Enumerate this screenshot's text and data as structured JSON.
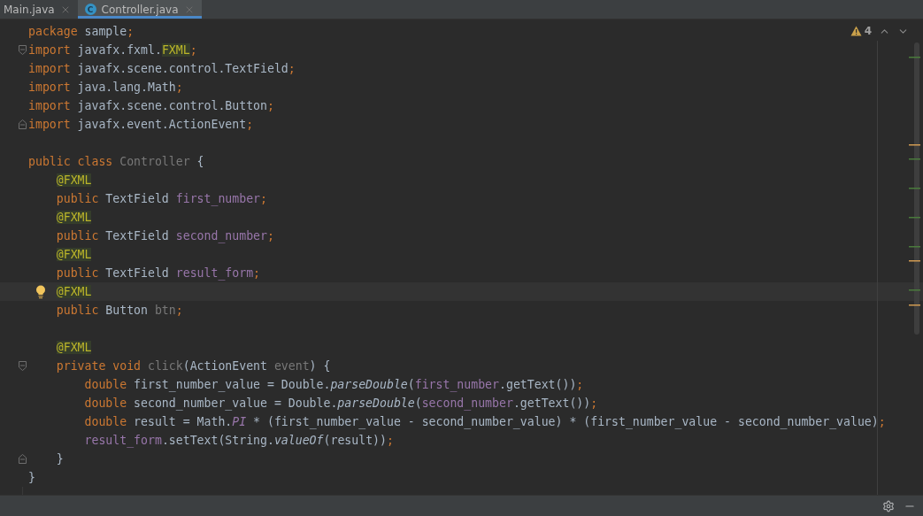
{
  "tabs": [
    {
      "label": "Main.java",
      "selected": false
    },
    {
      "label": "Controller.java",
      "selected": true,
      "icon_letter": "C"
    }
  ],
  "inspections": {
    "warning_count": "4"
  },
  "lines": [
    {
      "current": false,
      "fold_start": false,
      "fold_end": false,
      "tokens": [
        {
          "kind": "kw",
          "text": "package"
        },
        {
          "kind": "plain",
          "text": " sample"
        },
        {
          "kind": "punct",
          "text": ";"
        }
      ]
    },
    {
      "current": false,
      "fold_start": true,
      "fold_end": false,
      "tokens": [
        {
          "kind": "kw",
          "text": "import"
        },
        {
          "kind": "plain",
          "text": " javafx.fxml."
        },
        {
          "kind": "ann",
          "text": "FXML"
        },
        {
          "kind": "punct",
          "text": ";"
        }
      ]
    },
    {
      "current": false,
      "fold_start": false,
      "fold_end": false,
      "tokens": [
        {
          "kind": "kw",
          "text": "import"
        },
        {
          "kind": "plain",
          "text": " javafx.scene.control.TextField"
        },
        {
          "kind": "punct",
          "text": ";"
        }
      ]
    },
    {
      "current": false,
      "fold_start": false,
      "fold_end": false,
      "tokens": [
        {
          "kind": "kw",
          "text": "import"
        },
        {
          "kind": "plain",
          "text": " java.lang.Math"
        },
        {
          "kind": "punct",
          "text": ";"
        }
      ]
    },
    {
      "current": false,
      "fold_start": false,
      "fold_end": false,
      "tokens": [
        {
          "kind": "kw",
          "text": "import"
        },
        {
          "kind": "plain",
          "text": " javafx.scene.control.Button"
        },
        {
          "kind": "punct",
          "text": ";"
        }
      ]
    },
    {
      "current": false,
      "fold_start": false,
      "fold_end": true,
      "tokens": [
        {
          "kind": "kw",
          "text": "import"
        },
        {
          "kind": "plain",
          "text": " javafx.event.ActionEvent"
        },
        {
          "kind": "punct",
          "text": ";"
        }
      ]
    },
    {
      "current": false,
      "fold_start": false,
      "fold_end": false
    },
    {
      "current": false,
      "fold_start": false,
      "fold_end": false,
      "tokens": [
        {
          "kind": "kw",
          "text": "public class "
        },
        {
          "kind": "unused",
          "text": "Controller"
        },
        {
          "kind": "plain",
          "text": " {"
        }
      ]
    },
    {
      "current": false,
      "fold_start": false,
      "fold_end": false,
      "tokens": [
        {
          "kind": "ann",
          "text": "    @FXML"
        }
      ]
    },
    {
      "current": false,
      "fold_start": false,
      "fold_end": false,
      "tokens": [
        {
          "kind": "kw",
          "text": "    public "
        },
        {
          "kind": "plain",
          "text": "TextField "
        },
        {
          "kind": "field",
          "text": "first_number"
        },
        {
          "kind": "punct",
          "text": ";"
        }
      ]
    },
    {
      "current": false,
      "fold_start": false,
      "fold_end": false,
      "tokens": [
        {
          "kind": "ann",
          "text": "    @FXML"
        }
      ]
    },
    {
      "current": false,
      "fold_start": false,
      "fold_end": false,
      "tokens": [
        {
          "kind": "kw",
          "text": "    public "
        },
        {
          "kind": "plain",
          "text": "TextField "
        },
        {
          "kind": "field",
          "text": "second_number"
        },
        {
          "kind": "punct",
          "text": ";"
        }
      ]
    },
    {
      "current": false,
      "fold_start": false,
      "fold_end": false,
      "tokens": [
        {
          "kind": "ann",
          "text": "    @FXML"
        }
      ]
    },
    {
      "current": false,
      "fold_start": false,
      "fold_end": false,
      "tokens": [
        {
          "kind": "kw",
          "text": "    public "
        },
        {
          "kind": "plain",
          "text": "TextField "
        },
        {
          "kind": "field",
          "text": "result_form"
        },
        {
          "kind": "punct",
          "text": ";"
        }
      ]
    },
    {
      "current": true,
      "fold_start": false,
      "fold_end": false,
      "tokens": [
        {
          "kind": "ann",
          "text": "    @FXML"
        }
      ]
    },
    {
      "current": false,
      "fold_start": false,
      "fold_end": false,
      "tokens": [
        {
          "kind": "kw",
          "text": "    public "
        },
        {
          "kind": "plain",
          "text": "Button "
        },
        {
          "kind": "unused",
          "text": "btn"
        },
        {
          "kind": "punct",
          "text": ";"
        }
      ]
    },
    {
      "current": false,
      "fold_start": false,
      "fold_end": false
    },
    {
      "current": false,
      "fold_start": false,
      "fold_end": false,
      "tokens": [
        {
          "kind": "ann",
          "text": "    @FXML"
        }
      ]
    },
    {
      "current": false,
      "fold_start": true,
      "fold_end": false,
      "tokens": [
        {
          "kind": "kw",
          "text": "    private void "
        },
        {
          "kind": "unused",
          "text": "click"
        },
        {
          "kind": "plain",
          "text": "(ActionEvent "
        },
        {
          "kind": "unused",
          "text": "event"
        },
        {
          "kind": "plain",
          "text": ") {"
        }
      ]
    },
    {
      "current": false,
      "fold_start": false,
      "fold_end": false,
      "tokens": [
        {
          "kind": "kw",
          "text": "        double "
        },
        {
          "kind": "plain",
          "text": "first_number_value = Double."
        },
        {
          "kind": "static_m",
          "text": "parseDouble"
        },
        {
          "kind": "plain",
          "text": "("
        },
        {
          "kind": "field",
          "text": "first_number"
        },
        {
          "kind": "plain",
          "text": ".getText())"
        },
        {
          "kind": "punct",
          "text": ";"
        }
      ]
    },
    {
      "current": false,
      "fold_start": false,
      "fold_end": false,
      "tokens": [
        {
          "kind": "kw",
          "text": "        double "
        },
        {
          "kind": "plain",
          "text": "second_number_value = Double."
        },
        {
          "kind": "static_m",
          "text": "parseDouble"
        },
        {
          "kind": "plain",
          "text": "("
        },
        {
          "kind": "field",
          "text": "second_number"
        },
        {
          "kind": "plain",
          "text": ".getText())"
        },
        {
          "kind": "punct",
          "text": ";"
        }
      ]
    },
    {
      "current": false,
      "fold_start": false,
      "fold_end": false,
      "tokens": [
        {
          "kind": "kw",
          "text": "        double "
        },
        {
          "kind": "plain",
          "text": "result = Math."
        },
        {
          "kind": "static_f",
          "text": "PI"
        },
        {
          "kind": "plain",
          "text": " * (first_number_value - second_number_value) * (first_number_value - second_number_value)"
        },
        {
          "kind": "punct",
          "text": ";"
        }
      ]
    },
    {
      "current": false,
      "fold_start": false,
      "fold_end": false,
      "tokens": [
        {
          "kind": "field",
          "text": "        result_form"
        },
        {
          "kind": "plain",
          "text": ".setText(String."
        },
        {
          "kind": "static_m",
          "text": "valueOf"
        },
        {
          "kind": "plain",
          "text": "(result))"
        },
        {
          "kind": "punct",
          "text": ";"
        }
      ]
    },
    {
      "current": false,
      "fold_start": false,
      "fold_end": true,
      "tokens": [
        {
          "kind": "plain",
          "text": "    }"
        }
      ]
    },
    {
      "current": false,
      "fold_start": false,
      "fold_end": false,
      "tokens": [
        {
          "kind": "plain",
          "text": "}"
        }
      ]
    }
  ]
}
